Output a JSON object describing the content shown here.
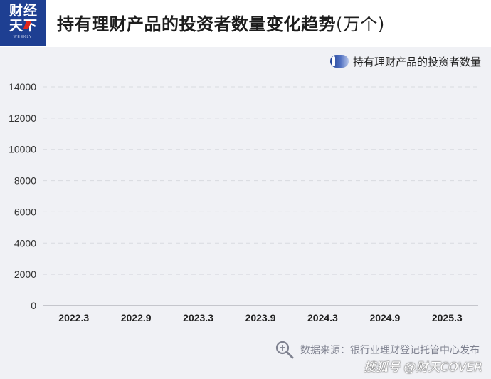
{
  "header": {
    "logo_top": "财经",
    "logo_bottom": "天下",
    "logo_sub": "WEEKLY",
    "title_main": "持有理财产品的投资者数量变化趋势",
    "title_unit": "(万个)"
  },
  "colors": {
    "brand_blue": "#1e3f92",
    "accent_red": "#e0261c",
    "panel_bg": "#f0f1f5",
    "grid": "#d8dae0"
  },
  "chart_data": {
    "type": "bar",
    "title": "持有理财产品的投资者数量变化趋势(万个)",
    "categories": [
      "2022.3",
      "2022.9",
      "2023.3",
      "2023.9",
      "2024.3",
      "2024.9",
      "2025.3"
    ],
    "series": [
      {
        "name": "持有理财产品的投资者数量",
        "values": []
      }
    ],
    "yticks": [
      0,
      2000,
      4000,
      6000,
      8000,
      10000,
      12000,
      14000
    ],
    "ylim": [
      0,
      14000
    ],
    "xlabel": "",
    "ylabel": "",
    "grid": true,
    "legend": "top-right"
  },
  "source": {
    "text": "数据来源：银行业理财登记托管中心发布"
  },
  "watermark": {
    "text": "搜狐号 @财天COVER"
  }
}
